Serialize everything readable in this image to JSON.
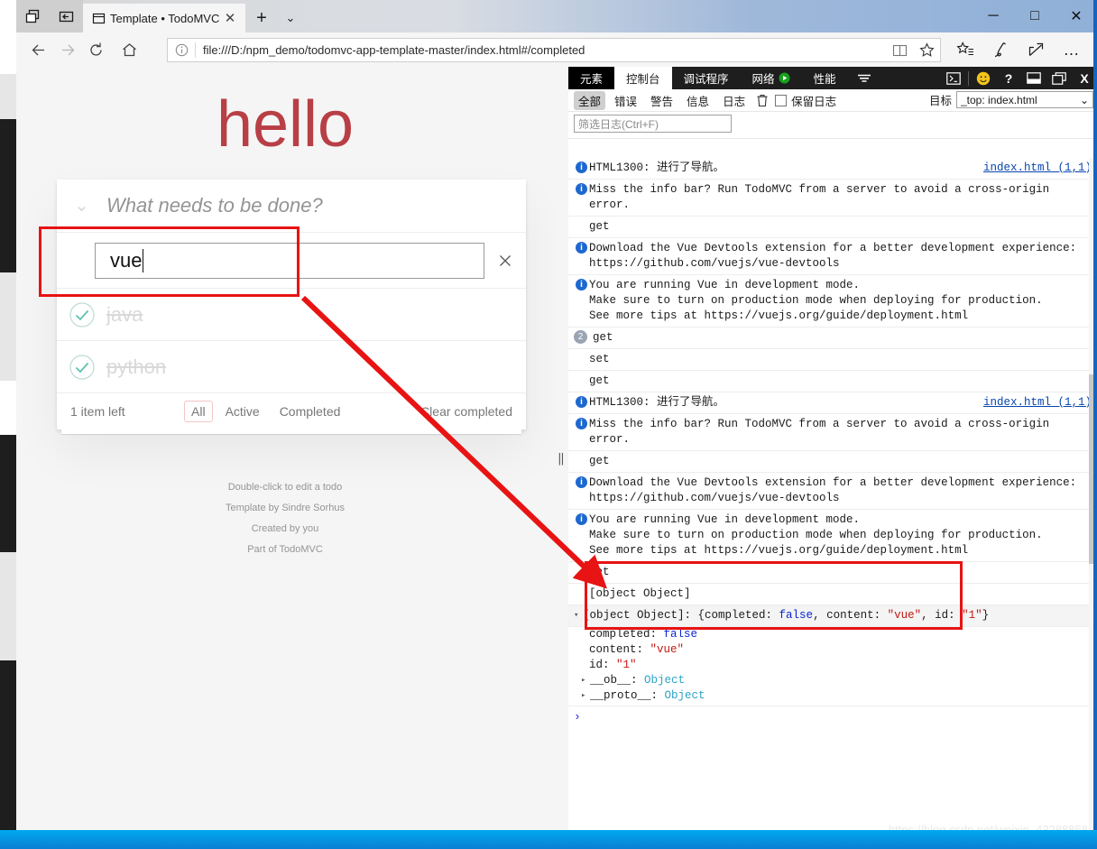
{
  "window": {
    "tab_title": "Template • TodoMVC",
    "url": "file:///D:/npm_demo/todomvc-app-template-master/index.html#/completed",
    "new_tab_label": "+",
    "minimize_label": "─",
    "maximize_label": "□",
    "close_label": "✕",
    "tab_close_label": "✕",
    "tab_list_label": "⌄"
  },
  "page": {
    "title": "hello",
    "new_todo_placeholder": "What needs to be done?",
    "toggle_all_label": "⌄",
    "editing": {
      "value": "vue",
      "clear_label": "✕"
    },
    "todos": [
      {
        "label": "java",
        "completed": true
      },
      {
        "label": "python",
        "completed": true
      }
    ],
    "footer": {
      "items_left": "1 item left",
      "filters": [
        {
          "label": "All",
          "selected": true
        },
        {
          "label": "Active",
          "selected": false
        },
        {
          "label": "Completed",
          "selected": false
        }
      ],
      "clear_completed": "Clear completed"
    },
    "info": [
      "Double-click to edit a todo",
      "Template by Sindre Sorhus",
      "Created by you",
      "Part of TodoMVC"
    ]
  },
  "devtools": {
    "tabs": [
      {
        "label": "元素",
        "active": false,
        "first": true
      },
      {
        "label": "控制台",
        "active": true
      },
      {
        "label": "调试程序",
        "active": false
      },
      {
        "label": "网络",
        "active": false,
        "icon": "play-icon"
      },
      {
        "label": "性能",
        "active": false
      }
    ],
    "more_tabs_label": "▼",
    "right_icons": [
      "console-toggle-icon",
      "feedback-smiley-icon",
      "help-icon",
      "dock-bottom-icon",
      "undock-icon",
      "close-icon"
    ],
    "help_label": "?",
    "close_label": "X",
    "levels": [
      {
        "label": "全部",
        "active": true
      },
      {
        "label": "错误",
        "active": false
      },
      {
        "label": "警告",
        "active": false
      },
      {
        "label": "信息",
        "active": false
      },
      {
        "label": "日志",
        "active": false
      }
    ],
    "clear_label": "clear-console-icon",
    "preserve_log_label": "保留日志",
    "target_label": "目标",
    "target_value": "_top: index.html",
    "target_caret": "⌄",
    "filter_placeholder": "筛选日志(Ctrl+F)",
    "prompt": "›",
    "messages": [
      {
        "kind": "info",
        "text": "HTML1300: 进行了导航。",
        "source": "index.html (1,1)"
      },
      {
        "kind": "info",
        "text": "Miss the info bar? Run TodoMVC from a server to avoid a cross-origin error."
      },
      {
        "kind": "plain",
        "text": "get"
      },
      {
        "kind": "info",
        "text": "Download the Vue Devtools extension for a better development experience:\nhttps://github.com/vuejs/vue-devtools"
      },
      {
        "kind": "info",
        "text": "You are running Vue in development mode.\nMake sure to turn on production mode when deploying for production.\nSee more tips at https://vuejs.org/guide/deployment.html"
      },
      {
        "kind": "plain",
        "text": "get",
        "count": "2"
      },
      {
        "kind": "plain",
        "text": "set"
      },
      {
        "kind": "plain",
        "text": "get"
      },
      {
        "kind": "info",
        "text": "HTML1300: 进行了导航。",
        "source": "index.html (1,1)"
      },
      {
        "kind": "info",
        "text": "Miss the info bar? Run TodoMVC from a server to avoid a cross-origin error."
      },
      {
        "kind": "plain",
        "text": "get"
      },
      {
        "kind": "info",
        "text": "Download the Vue Devtools extension for a better development experience:\nhttps://github.com/vuejs/vue-devtools"
      },
      {
        "kind": "info",
        "text": "You are running Vue in development mode.\nMake sure to turn on production mode when deploying for production.\nSee more tips at https://vuejs.org/guide/deployment.html"
      },
      {
        "kind": "plain",
        "text": "get"
      },
      {
        "kind": "plain",
        "text": "[object Object]"
      }
    ],
    "expanded_object": {
      "header_prefix": "[object Object]: {",
      "header_suffix": "}",
      "header_parts": [
        {
          "key": "completed: ",
          "value": "false",
          "type": "kw",
          "sep": ", "
        },
        {
          "key": "content: ",
          "value": "\"vue\"",
          "type": "str",
          "sep": ", "
        },
        {
          "key": "id: ",
          "value": "\"1\"",
          "type": "str",
          "sep": ""
        }
      ],
      "rows": [
        {
          "key": "completed: ",
          "value": "false",
          "type": "kw"
        },
        {
          "key": "content: ",
          "value": "\"vue\"",
          "type": "str"
        },
        {
          "key": "id: ",
          "value": "\"1\"",
          "type": "str"
        }
      ],
      "proto_rows": [
        {
          "caret": "▸",
          "key": "__ob__: ",
          "value": "Object",
          "type": "obj"
        },
        {
          "caret": "▸",
          "key": "__proto__: ",
          "value": "Object",
          "type": "obj"
        }
      ],
      "collapse_caret": "▾"
    }
  },
  "annotations": {
    "highlight_color": "#e81313",
    "arrow_label": "red-arrow-annotation"
  },
  "watermark": "https://blog.csdn.net/weixin_43288858"
}
